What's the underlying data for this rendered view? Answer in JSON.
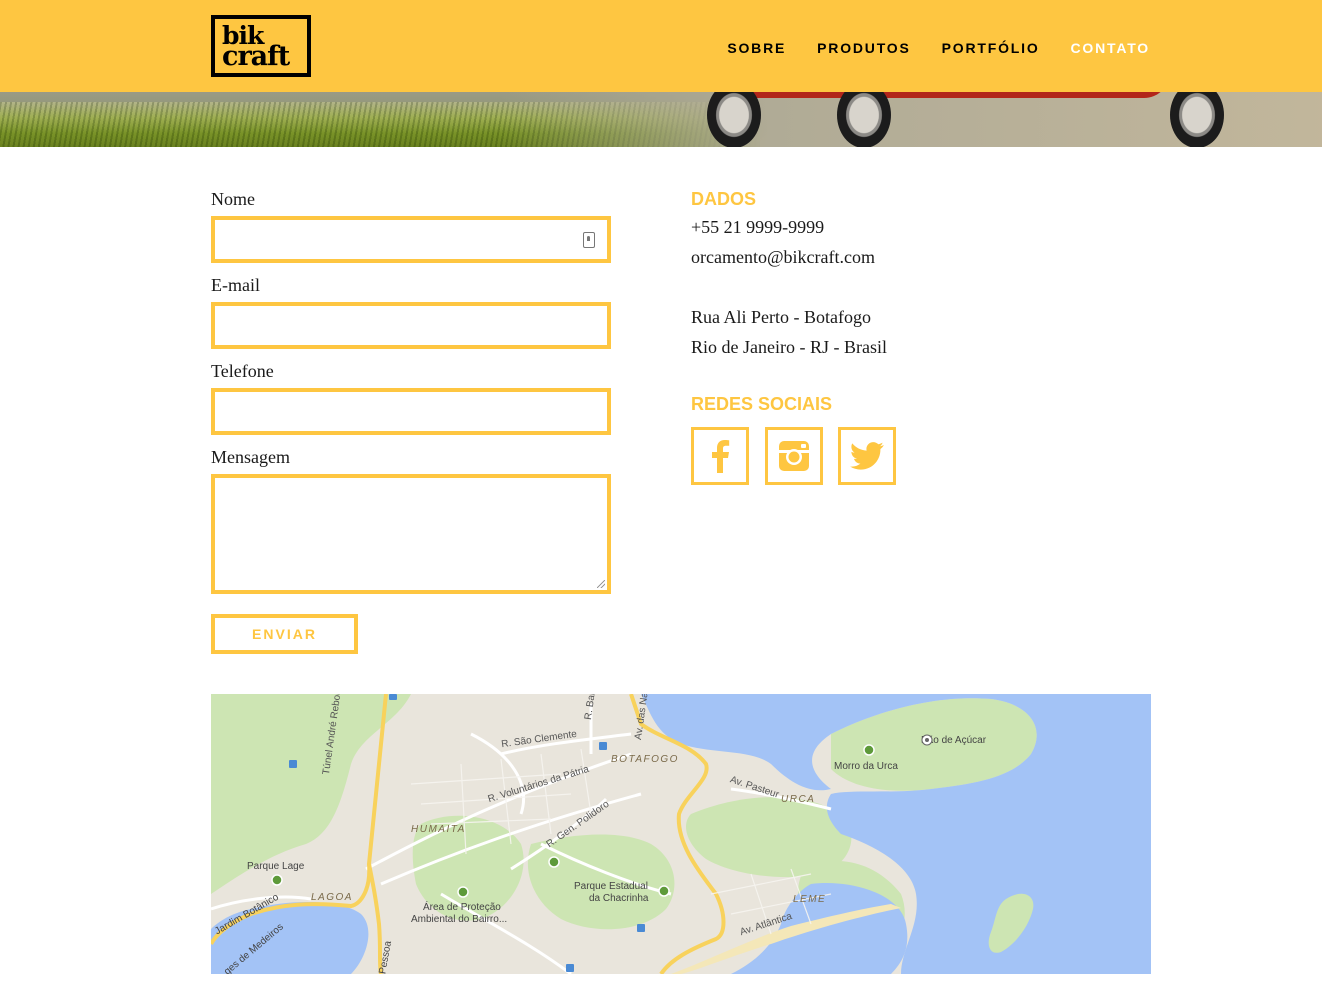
{
  "header": {
    "logo": {
      "line1": "bik",
      "line2": "craft"
    },
    "nav": [
      {
        "label": "SOBRE",
        "active": false
      },
      {
        "label": "PRODUTOS",
        "active": false
      },
      {
        "label": "PORTFÓLIO",
        "active": false
      },
      {
        "label": "CONTATO",
        "active": true
      }
    ]
  },
  "form": {
    "name_label": "Nome",
    "name_value": "",
    "email_label": "E-mail",
    "email_value": "",
    "phone_label": "Telefone",
    "phone_value": "",
    "message_label": "Mensagem",
    "message_value": "",
    "submit_label": "ENVIAR"
  },
  "contact": {
    "title": "DADOS",
    "phone": "+55 21 9999-9999",
    "email": "orcamento@bikcraft.com",
    "address_line1": "Rua Ali Perto - Botafogo",
    "address_line2": "Rio de Janeiro - RJ - Brasil"
  },
  "social": {
    "title": "REDES SOCIAIS",
    "items": [
      {
        "icon": "facebook-icon"
      },
      {
        "icon": "instagram-icon"
      },
      {
        "icon": "twitter-icon"
      }
    ]
  },
  "map": {
    "labels": {
      "sao_clemente": "R. São Clemente",
      "voluntarios": "R. Voluntários da Pátria",
      "gen_polidoro": "R. Gen. Polidoro",
      "tunel": "Túnel André Rebouças",
      "botafogo": "BOTAFOGO",
      "humaita": "HUMAITA",
      "urca": "URCA",
      "lagoa": "LAGOA",
      "leme": "LEME",
      "av_pasteur": "Av. Pasteur",
      "av_atlantica": "Av. Atlântica",
      "av_nacoes": "Av. das Naç",
      "r_bam": "R. Bam",
      "pao_de_acucar": "Pão de Açúcar",
      "morro_da_urca": "Morro da Urca",
      "parque_lage": "Parque Lage",
      "parque_chacrinha_1": "Parque Estadual",
      "parque_chacrinha_2": "da Chacrinha",
      "area_protecao_1": "Área de Proteção",
      "area_protecao_2": "Ambiental do Bairro...",
      "jardim_botanico": "Jardim Botânico",
      "medeiros": "ges de Medeiros",
      "pessoa": "Pessoa"
    },
    "colors": {
      "water": "#a3c3f6",
      "park": "#cde5b3",
      "land": "#e9e5dc",
      "highway": "#f8d25c"
    }
  }
}
